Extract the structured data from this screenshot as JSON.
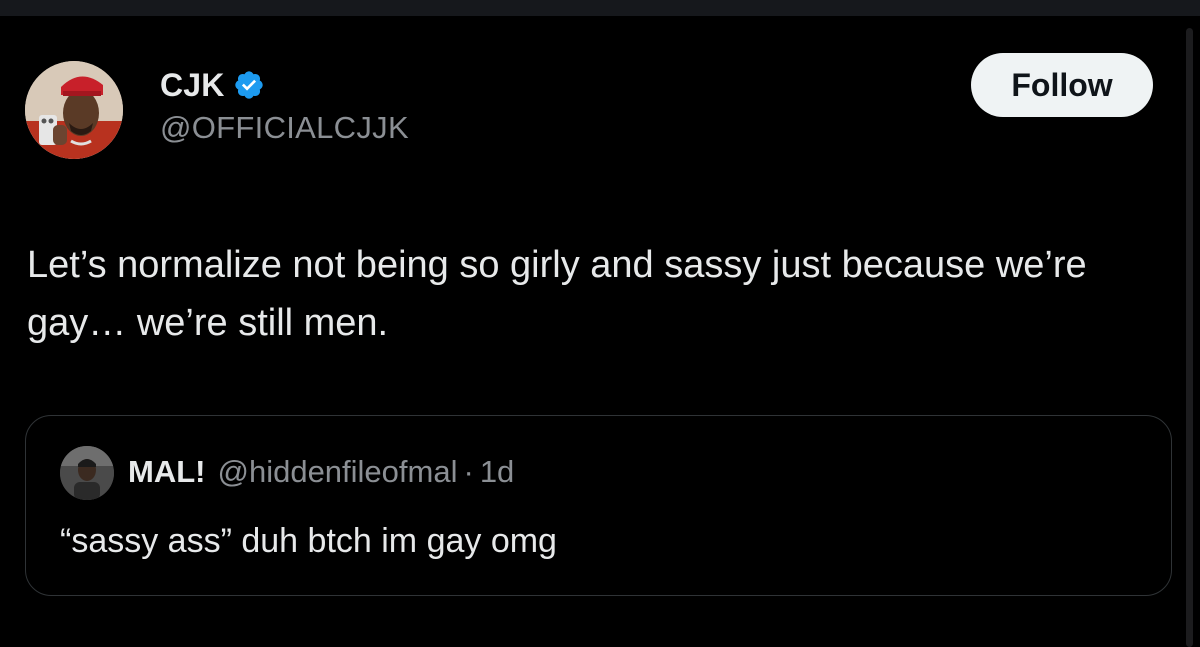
{
  "tweet": {
    "author": {
      "display_name": "CJK",
      "handle": "@OFFICIALCJJK",
      "verified_icon": "verified-badge-icon",
      "avatar_icon": "avatar-photo"
    },
    "follow_label": "Follow",
    "text": "Let’s normalize not being so girly and sassy just because we’re gay… we’re still men."
  },
  "quote": {
    "author": {
      "display_name": "MAL!",
      "handle": "@hiddenfileofmal",
      "avatar_icon": "avatar-photo"
    },
    "separator": "·",
    "time": "1d",
    "text": "“sassy ass” duh btch im gay omg"
  },
  "colors": {
    "background": "#000000",
    "text_primary": "#e7e9ea",
    "text_secondary": "#8b8f94",
    "verified_blue": "#1d9bf0",
    "follow_bg": "#eff3f4",
    "border": "#2f3336"
  }
}
